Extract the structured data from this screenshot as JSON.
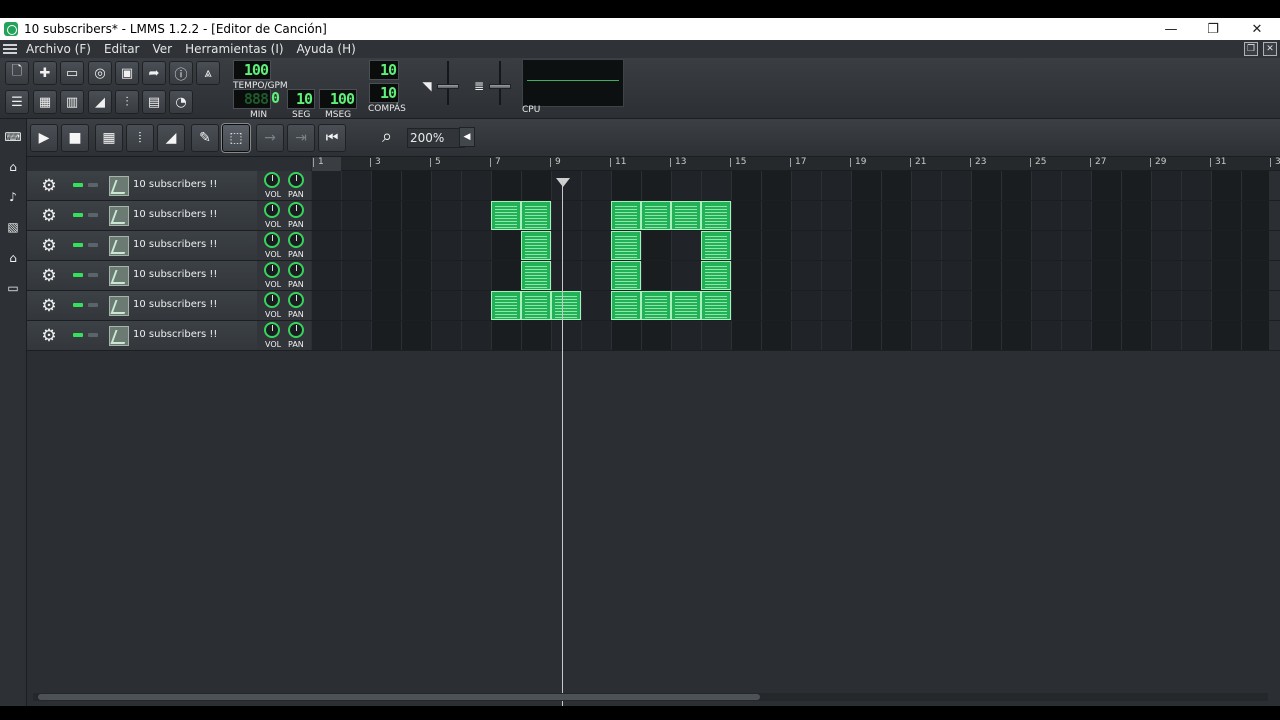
{
  "window": {
    "title": "10 subscribers* - LMMS 1.2.2 - [Editor de Canción]",
    "minimize": "—",
    "restore": "❐",
    "close": "✕"
  },
  "menu": [
    "Archivo (F)",
    "Editar",
    "Ver",
    "Herramientas (I)",
    "Ayuda (H)"
  ],
  "toolbar": {
    "tempo_value": "100",
    "tempo_label": "TEMPO/GPM",
    "time_ghost": "888",
    "time_min": "0",
    "time_sec": "10",
    "time_msec": "100",
    "min_label": "MIN",
    "sec_label": "SEG",
    "msec_label": "MSEG",
    "sig_num": "10",
    "sig_den": "10",
    "sig_label": "COMPÁS",
    "cpu_label": "CPU"
  },
  "song_editor": {
    "zoom": "200%"
  },
  "ruler_marks": [
    "1",
    "3",
    "5",
    "7",
    "9",
    "11",
    "13",
    "15",
    "17",
    "19",
    "21",
    "23",
    "25",
    "27",
    "29",
    "31",
    "3"
  ],
  "tracks": [
    {
      "name": "10 subscribers !!",
      "vol": "VOL",
      "pan": "PAN",
      "clips": []
    },
    {
      "name": "10 subscribers !!",
      "vol": "VOL",
      "pan": "PAN",
      "clips": [
        6,
        7,
        10,
        11,
        12,
        13
      ]
    },
    {
      "name": "10 subscribers !!",
      "vol": "VOL",
      "pan": "PAN",
      "clips": [
        7,
        10,
        13
      ]
    },
    {
      "name": "10 subscribers !!",
      "vol": "VOL",
      "pan": "PAN",
      "clips": [
        7,
        10,
        13
      ]
    },
    {
      "name": "10 subscribers !!",
      "vol": "VOL",
      "pan": "PAN",
      "clips": [
        6,
        7,
        8,
        10,
        11,
        12,
        13
      ]
    },
    {
      "name": "10 subscribers !!",
      "vol": "VOL",
      "pan": "PAN",
      "clips": []
    }
  ],
  "colors": {
    "accent_green": "#22b156",
    "lcd_green": "#5ff07a",
    "background": "#2b2f33"
  }
}
